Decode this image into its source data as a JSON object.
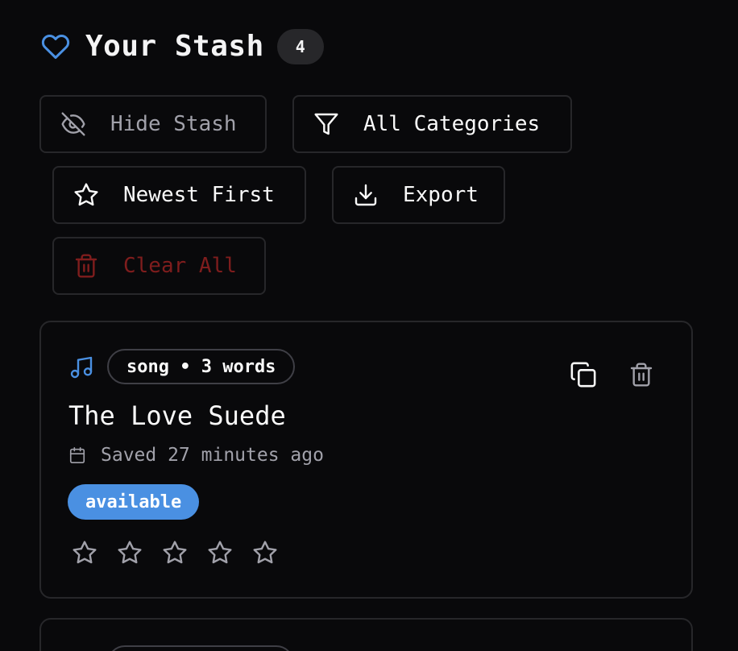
{
  "header": {
    "title": "Your Stash",
    "count": "4",
    "icon": "heart-icon",
    "icon_color": "#4a90e2"
  },
  "toolbar": {
    "hide_label": "Hide Stash",
    "category_label": "All Categories",
    "sort_label": "Newest First",
    "export_label": "Export",
    "clear_label": "Clear All",
    "icons": [
      "eye-off-icon",
      "filter-icon",
      "star-icon",
      "download-icon",
      "trash-icon"
    ],
    "clear_color": "#7f1d1d"
  },
  "items": [
    {
      "category_icon": "music-note-icon",
      "meta": "song • 3 words",
      "title": "The Love Suede",
      "saved": "Saved 27 minutes ago",
      "status": "available",
      "status_color": "#4a90e2",
      "rating": 0,
      "rating_max": 5
    }
  ],
  "colors": {
    "background": "#09090b",
    "border": "#27272a",
    "accent": "#4a90e2"
  }
}
